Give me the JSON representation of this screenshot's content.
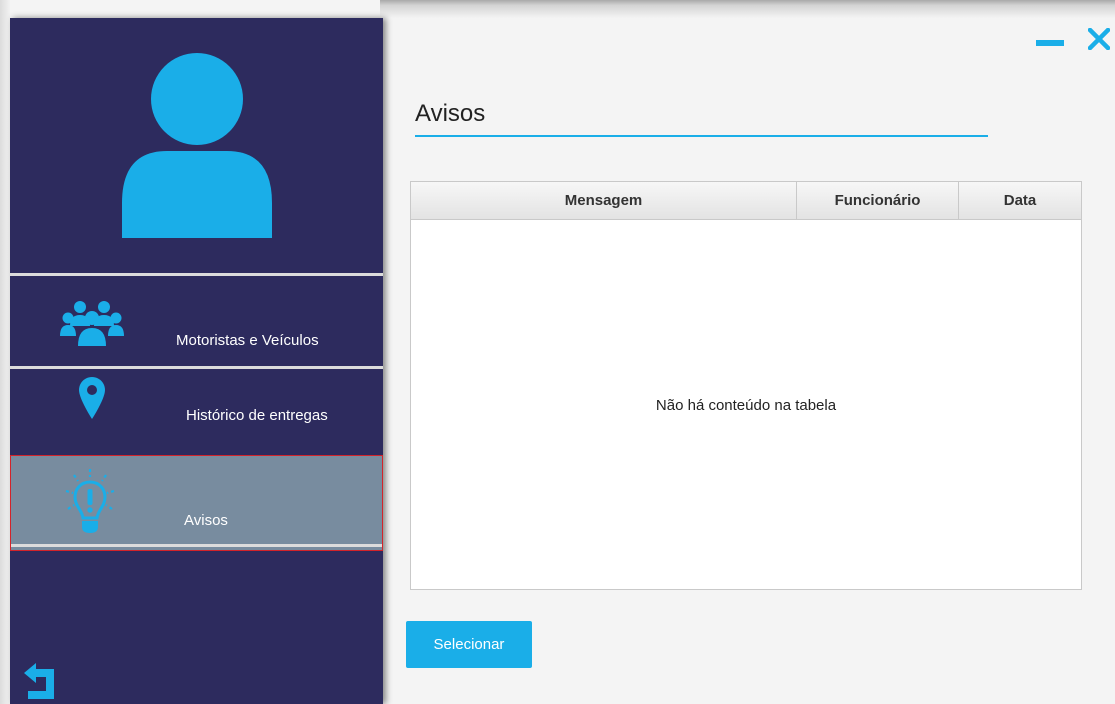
{
  "window": {
    "title": "",
    "minimize_icon": "minimize-icon",
    "close_icon": "close-icon",
    "accent_color": "#1aaee8",
    "sidebar_color": "#2d2b5e",
    "active_item_color": "#788c9f"
  },
  "sidebar": {
    "avatar_icon": "user-avatar-icon",
    "items": [
      {
        "label": "Motoristas e Veículos",
        "icon": "group-people-icon",
        "active": false
      },
      {
        "label": "Histórico de entregas",
        "icon": "map-pin-icon",
        "active": false
      },
      {
        "label": "Avisos",
        "icon": "lightbulb-icon",
        "active": true
      }
    ],
    "back_icon": "back-arrow-icon"
  },
  "main": {
    "title": "Avisos",
    "table": {
      "columns": [
        "Mensagem",
        "Funcionário",
        "Data"
      ],
      "rows": [],
      "empty_text": "Não há conteúdo na tabela"
    },
    "select_button": "Selecionar"
  }
}
